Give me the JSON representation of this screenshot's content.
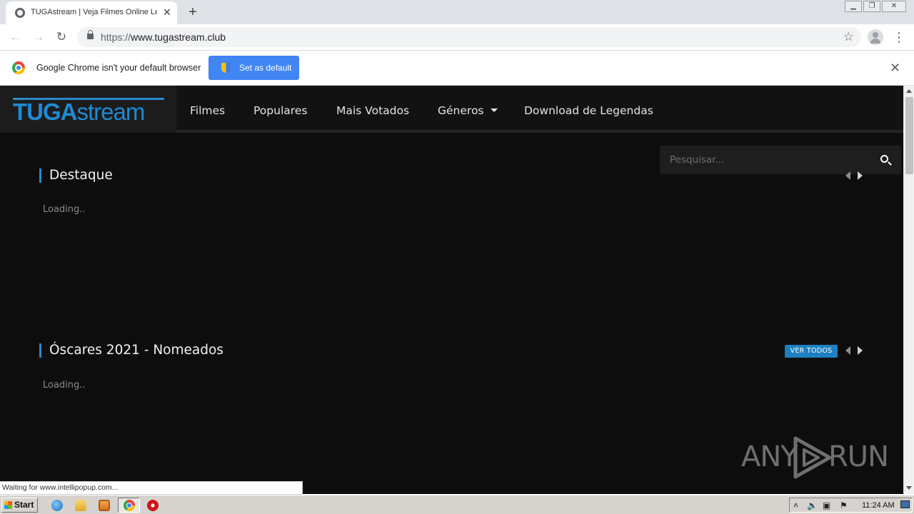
{
  "browser": {
    "tab_title": "TUGAstream | Veja Filmes Online Legendados",
    "tab_close": "✕",
    "new_tab": "+",
    "window_controls": {
      "minimize": "▁",
      "restore": "❐",
      "close": "✕"
    },
    "url_scheme": "https://",
    "url_host": "www.tugastream.club",
    "infobar": {
      "message": "Google Chrome isn't your default browser",
      "button": "Set as default",
      "close": "✕"
    },
    "status": "Waiting for www.intellipopup.com..."
  },
  "site": {
    "logo_bold": "TUGA",
    "logo_light": "stream",
    "nav": [
      "Filmes",
      "Populares",
      "Mais Votados",
      "Géneros",
      "Download de Legendas"
    ],
    "search_placeholder": "Pesquisar...",
    "sections": [
      {
        "title": "Destaque",
        "loading": "Loading.."
      },
      {
        "title": "Óscares 2021 - Nomeados",
        "loading": "Loading..",
        "button": "VER TODOS"
      }
    ],
    "accent_color": "#1f8ad2"
  },
  "watermark": {
    "left": "ANY",
    "right": "RUN"
  },
  "taskbar": {
    "start": "Start",
    "clock": "11:24 AM",
    "tray_icons": [
      "expand-tray-icon",
      "speaker-icon",
      "network-icon",
      "flag-icon"
    ]
  }
}
